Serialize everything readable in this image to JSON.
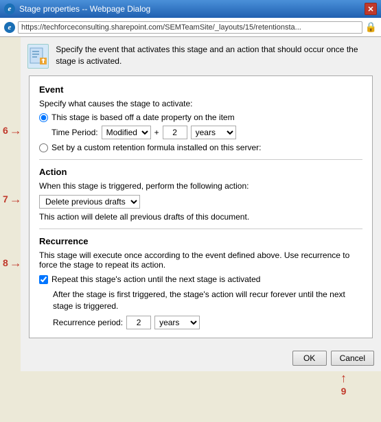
{
  "window": {
    "title": "Stage properties -- Webpage Dialog",
    "close_label": "✕"
  },
  "address_bar": {
    "url": "https://techforceconsulting.sharepoint.com/SEMTeamSite/_layouts/15/retentionsta..."
  },
  "info": {
    "text": "Specify the event that activates this stage and an action that should occur once the stage is activated."
  },
  "event_section": {
    "title": "Event",
    "specify_label": "Specify what causes the stage to activate:",
    "radio1_label": "This stage is based off a date property on the item",
    "time_period_label": "Time Period:",
    "modified_option": "Modified",
    "plus_sign": "+ 2",
    "number_value": "2",
    "years_label": "years",
    "radio2_label": "Set by a custom retention formula installed on this server:"
  },
  "action_section": {
    "title": "Action",
    "when_label": "When this stage is triggered, perform the following action:",
    "action_option": "Delete previous drafts",
    "action_description": "This action will delete all previous drafts of this document."
  },
  "recurrence_section": {
    "title": "Recurrence",
    "description": "This stage will execute once according to the event defined above. Use recurrence to force the stage to repeat its action.",
    "checkbox_label": "Repeat this stage's action until the next stage is activated",
    "indent_text": "After the stage is first triggered, the stage's action will recur forever until the next stage is triggered.",
    "recurrence_period_label": "Recurrence period:",
    "recurrence_value": "2",
    "recurrence_unit": "years"
  },
  "footer": {
    "ok_label": "OK",
    "cancel_label": "Cancel"
  },
  "annotations": {
    "six": "6",
    "seven": "7",
    "eight": "8",
    "nine": "9"
  }
}
